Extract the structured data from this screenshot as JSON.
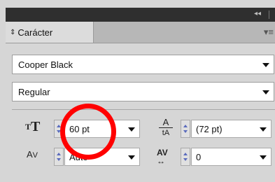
{
  "panel": {
    "tab_label": "Carácter",
    "tab_icon": "collapse-arrows-icon",
    "collapse_glyph": "◂◂",
    "menu_glyph": "▾≡"
  },
  "font_family": {
    "value": "Cooper Black"
  },
  "font_style": {
    "value": "Regular"
  },
  "font_size": {
    "value": "60 pt",
    "icon": "font-size-icon",
    "icon_glyph": "T"
  },
  "leading": {
    "value": "(72 pt)",
    "icon": "leading-icon",
    "icon_glyph": "A"
  },
  "kerning": {
    "value": "Auto",
    "icon": "kerning-icon",
    "icon_glyph": "A"
  },
  "tracking": {
    "value": "0",
    "icon": "tracking-icon",
    "icon_glyph": "AV"
  },
  "annotation": {
    "color": "#ff0000"
  }
}
